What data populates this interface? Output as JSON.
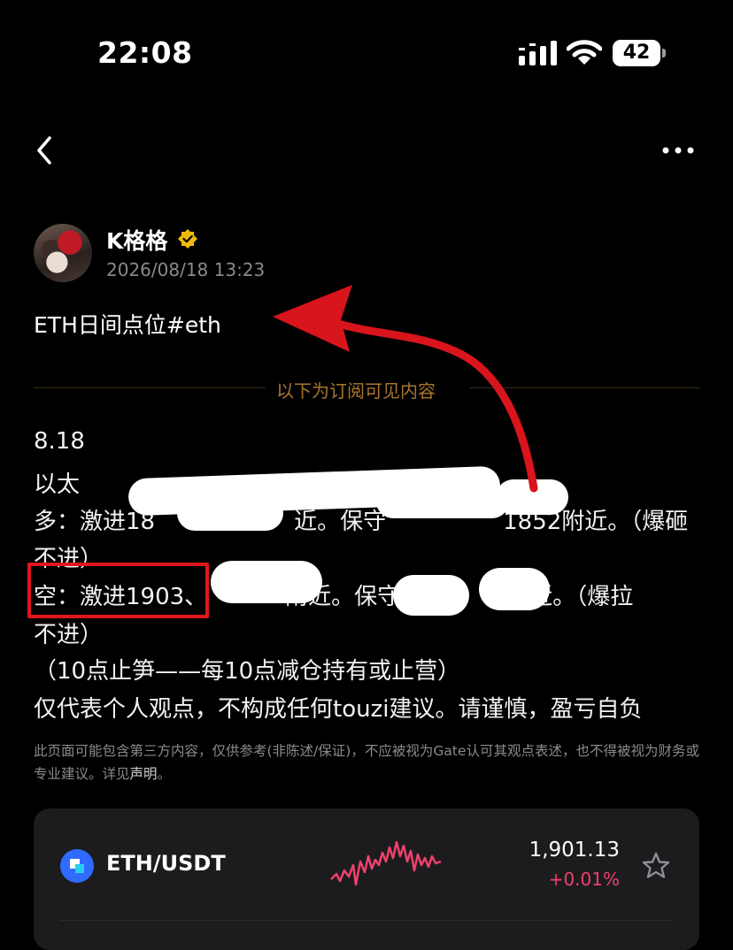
{
  "status_bar": {
    "time": "22:08",
    "battery": "42"
  },
  "nav": {
    "back_icon": "chevron-left-icon",
    "more_icon": "ellipsis-icon"
  },
  "author": {
    "name": "K格格",
    "date": "2026/08/18 13:23",
    "verified_icon": "verified-badge-icon"
  },
  "post": {
    "title": "ETH日间点位#eth",
    "subscriber_divider": "以下为订阅可见内容",
    "lines": [
      "8.18",
      "以太",
      "多：激进18",
      "近。保守",
      "1852附近。（爆砸",
      "不进）",
      "空：激进1903、",
      "附近。保守",
      "附近。（爆拉",
      "不进）",
      "（10点止笋——每10点减仓持有或止营）",
      "仅代表个人观点，不构成任何touzi建议。请谨慎，盈亏自负"
    ]
  },
  "disclaimer": {
    "text": "此页面可能包含第三方内容，仅供参考(非陈述/保证)，不应被视为Gate认可其观点表述，也不得被视为财务或专业建议。详见",
    "link": "声明",
    "end": "。"
  },
  "ticker": {
    "pair": "ETH/USDT",
    "price": "1,901.13",
    "change": "+0.01%",
    "change_color": "#f0416c",
    "star_icon": "star-outline-icon"
  }
}
